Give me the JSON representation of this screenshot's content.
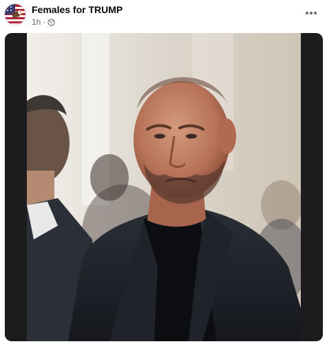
{
  "post": {
    "author": "Females for TRUMP",
    "timestamp": "1h",
    "separator": "·",
    "privacy_icon": "globe-icon",
    "more_icon": "more-options-icon",
    "avatar_icon": "eagle-flag-avatar",
    "image": {
      "description_icon": "man-in-dark-suit-photo"
    }
  },
  "colors": {
    "author_text": "#050505",
    "meta_text": "#65676b",
    "frame_bg": "#1c1c1e"
  }
}
